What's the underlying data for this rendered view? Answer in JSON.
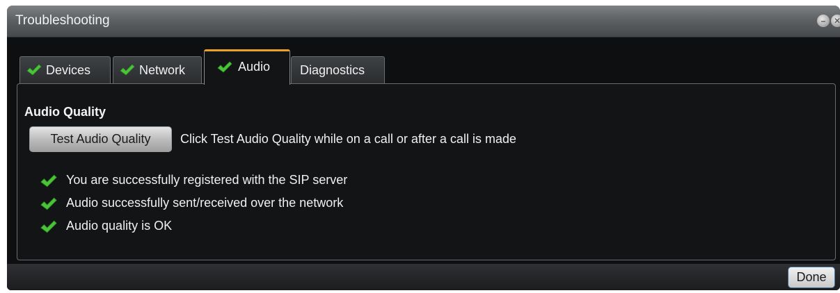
{
  "window": {
    "title": "Troubleshooting",
    "minimize_glyph": "–",
    "close_glyph": "✕"
  },
  "tabs": [
    {
      "label": "Devices",
      "checked": true,
      "active": false
    },
    {
      "label": "Network",
      "checked": true,
      "active": false
    },
    {
      "label": "Audio",
      "checked": true,
      "active": true
    },
    {
      "label": "Diagnostics",
      "checked": false,
      "active": false
    }
  ],
  "audio_panel": {
    "section_title": "Audio Quality",
    "test_button_label": "Test Audio Quality",
    "hint": "Click Test Audio Quality while on a call or after a call is made",
    "status_items": [
      "You are successfully registered with the SIP server",
      "Audio successfully sent/received over the network",
      "Audio quality is OK"
    ]
  },
  "footer": {
    "done_label": "Done"
  },
  "colors": {
    "window_bg": "#0e0f10",
    "active_tab_accent": "#e8a228",
    "check_green": "#4cc43a",
    "text": "#f0f0f0"
  },
  "icons": {
    "check": "check-icon",
    "minimize": "minimize-icon",
    "close": "close-icon"
  }
}
